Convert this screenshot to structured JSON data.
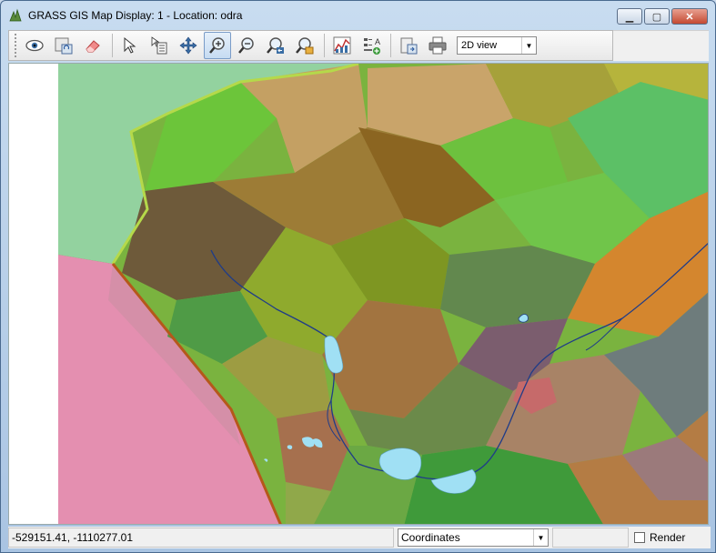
{
  "window": {
    "title": "GRASS GIS Map Display: 1 - Location: odra",
    "controls": {
      "minimize": "▁",
      "maximize": "▢",
      "close": "✕"
    }
  },
  "toolbar": {
    "buttons": [
      {
        "name": "display-map-icon",
        "active": false
      },
      {
        "name": "render-map-icon",
        "active": false
      },
      {
        "name": "erase-icon",
        "active": false
      },
      {
        "name": "pointer-icon",
        "active": false
      },
      {
        "name": "query-icon",
        "active": false
      },
      {
        "name": "pan-icon",
        "active": false
      },
      {
        "name": "zoom-in-icon",
        "active": true
      },
      {
        "name": "zoom-out-icon",
        "active": false
      },
      {
        "name": "zoom-back-icon",
        "active": false
      },
      {
        "name": "zoom-options-icon",
        "active": false
      },
      {
        "name": "analyze-icon",
        "active": false
      },
      {
        "name": "overlay-icon",
        "active": false
      },
      {
        "name": "save-image-icon",
        "active": false
      },
      {
        "name": "print-icon",
        "active": false
      }
    ],
    "view_mode": "2D view"
  },
  "statusbar": {
    "coordinates": "-529151.41, -1110277.01",
    "mode": "Coordinates",
    "render_label": "Render",
    "render_checked": false
  },
  "colors": {
    "accent": "#7a9cc8",
    "close": "#c44a32",
    "water": "#a0e0f4",
    "stream": "#1f3c88"
  }
}
